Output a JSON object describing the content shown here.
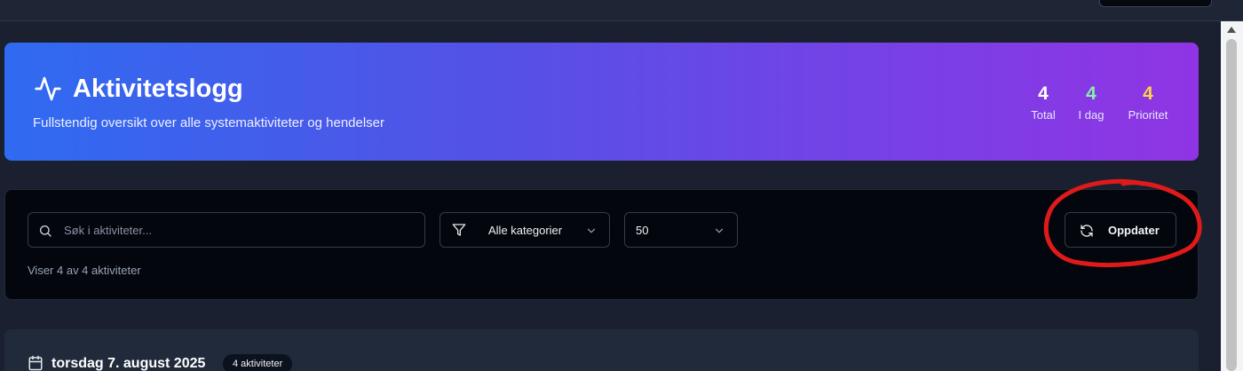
{
  "header": {
    "title": "Aktivitetslogg",
    "subtitle": "Fullstendig oversikt over alle systemaktiviteter og hendelser",
    "icon": "activity-icon"
  },
  "stats": [
    {
      "value": "4",
      "label": "Total",
      "color": "#ffffff"
    },
    {
      "value": "4",
      "label": "I dag",
      "color": "#86efac"
    },
    {
      "value": "4",
      "label": "Prioritet",
      "color": "#fcd34d"
    }
  ],
  "filters": {
    "search_placeholder": "Søk i aktiviteter...",
    "search_value": "",
    "category_selected": "Alle kategorier",
    "limit_selected": "50",
    "refresh_label": "Oppdater",
    "count_text": "Viser 4 av 4 aktiviteter"
  },
  "day_group": {
    "date": "torsdag 7. august 2025",
    "badge": "4 aktiviteter"
  },
  "colors": {
    "background": "#1a2030",
    "gradient_start": "#2f6bf1",
    "gradient_end": "#9034e4",
    "panel": "#03060d",
    "annotation": "#e01a1a"
  }
}
